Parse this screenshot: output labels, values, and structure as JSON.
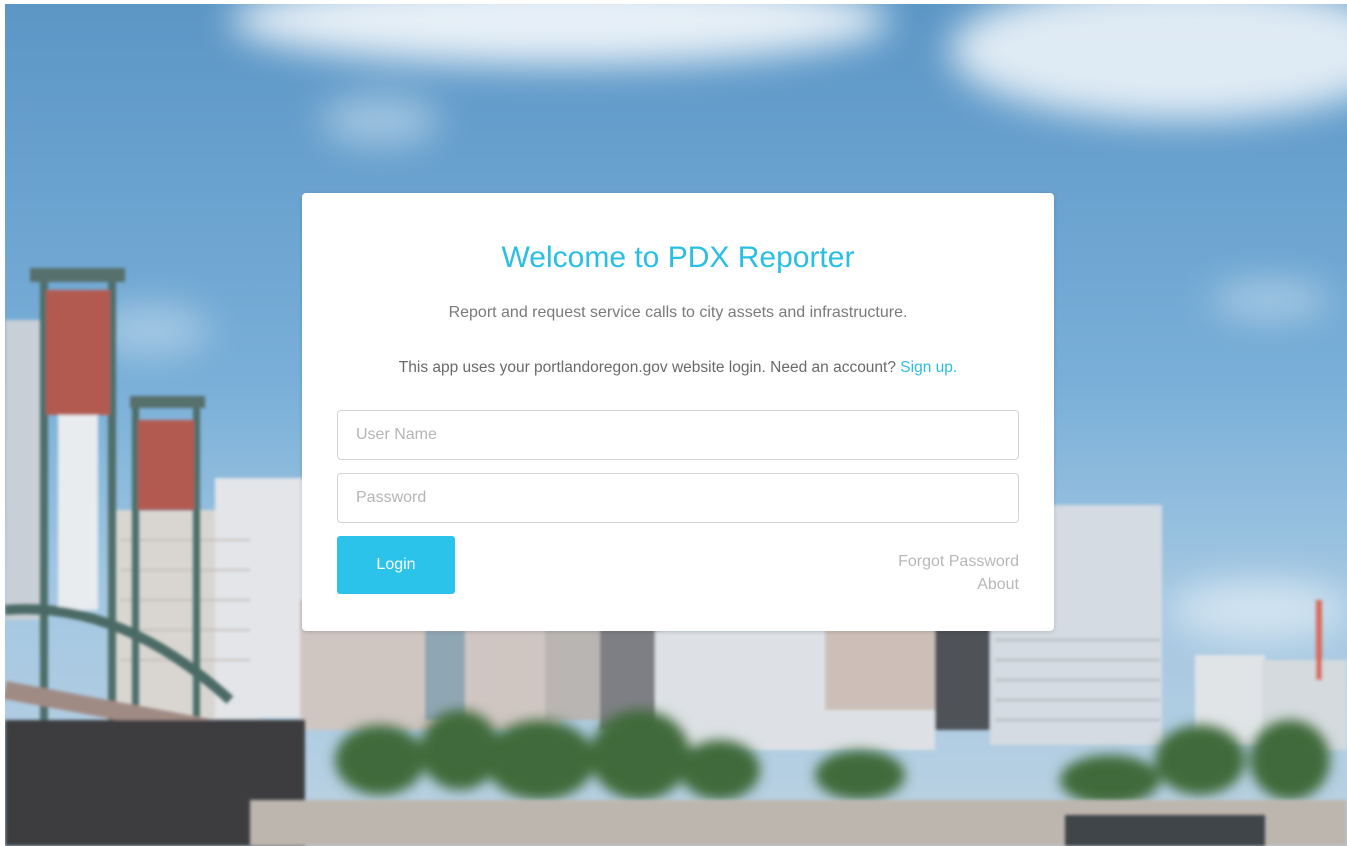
{
  "login": {
    "title": "Welcome to PDX Reporter",
    "subtitle": "Report and request service calls to city assets and infrastructure.",
    "notice_text": "This app uses your portlandoregon.gov website login. Need an account? ",
    "signup_link": "Sign up.",
    "username_placeholder": "User Name",
    "password_placeholder": "Password",
    "login_label": "Login",
    "forgot_password_label": "Forgot Password",
    "about_label": "About"
  },
  "colors": {
    "accent": "#29bfe3",
    "button": "#2bc3ea"
  }
}
